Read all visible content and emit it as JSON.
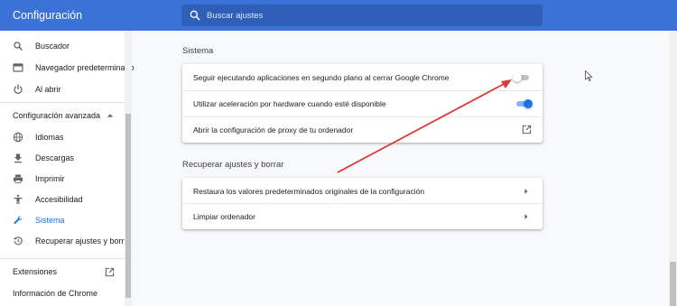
{
  "app": {
    "title": "Configuración"
  },
  "search": {
    "placeholder": "Buscar ajustes"
  },
  "sidebar": {
    "items": [
      {
        "label": "Buscador",
        "icon": "search-icon"
      },
      {
        "label": "Navegador predeterminado",
        "icon": "browser-window-icon"
      },
      {
        "label": "Al abrir",
        "icon": "power-icon"
      }
    ],
    "advanced_header": "Configuración avanzada",
    "advanced_items": [
      {
        "label": "Idiomas",
        "icon": "globe-icon"
      },
      {
        "label": "Descargas",
        "icon": "download-icon"
      },
      {
        "label": "Imprimir",
        "icon": "printer-icon"
      },
      {
        "label": "Accesibilidad",
        "icon": "accessibility-icon"
      },
      {
        "label": "Sistema",
        "icon": "wrench-icon",
        "active": true
      },
      {
        "label": "Recuperar ajustes y borrar",
        "icon": "history-icon"
      }
    ],
    "extensions_label": "Extensiones",
    "about_label": "Información de Chrome"
  },
  "main": {
    "system_title": "Sistema",
    "system_rows": [
      {
        "label": "Seguir ejecutando aplicaciones en segundo plano al cerrar Google Chrome",
        "control": "toggle",
        "on": false
      },
      {
        "label": "Utilizar aceleración por hardware cuando esté disponible",
        "control": "toggle",
        "on": true
      },
      {
        "label": "Abrir la configuración de proxy de tu ordenador",
        "control": "external-link"
      }
    ],
    "reset_title": "Recuperar ajustes y borrar",
    "reset_rows": [
      {
        "label": "Restaura los valores predeterminados originales de la configuración",
        "control": "chevron"
      },
      {
        "label": "Limpiar ordenador",
        "control": "chevron"
      }
    ]
  },
  "colors": {
    "header": "#3b72d8",
    "accent": "#1a73e8",
    "annotation_arrow": "#d93a3a"
  }
}
